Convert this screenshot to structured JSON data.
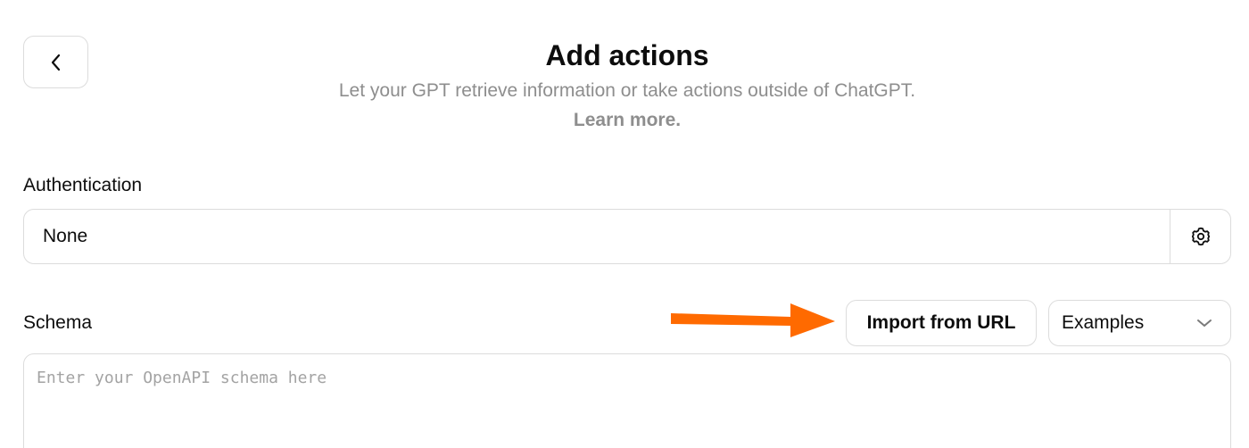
{
  "header": {
    "title": "Add actions",
    "subtitle": "Let your GPT retrieve information or take actions outside of ChatGPT.",
    "learn_more": "Learn more."
  },
  "back_button": {
    "icon": "chevron-left-icon"
  },
  "authentication": {
    "label": "Authentication",
    "value": "None",
    "settings_icon": "gear-icon"
  },
  "schema": {
    "label": "Schema",
    "import_label": "Import from URL",
    "examples_label": "Examples",
    "examples_icon": "chevron-down-icon",
    "placeholder": "Enter your OpenAPI schema here",
    "value": ""
  },
  "annotation": {
    "arrow_color": "#ff6a00"
  }
}
